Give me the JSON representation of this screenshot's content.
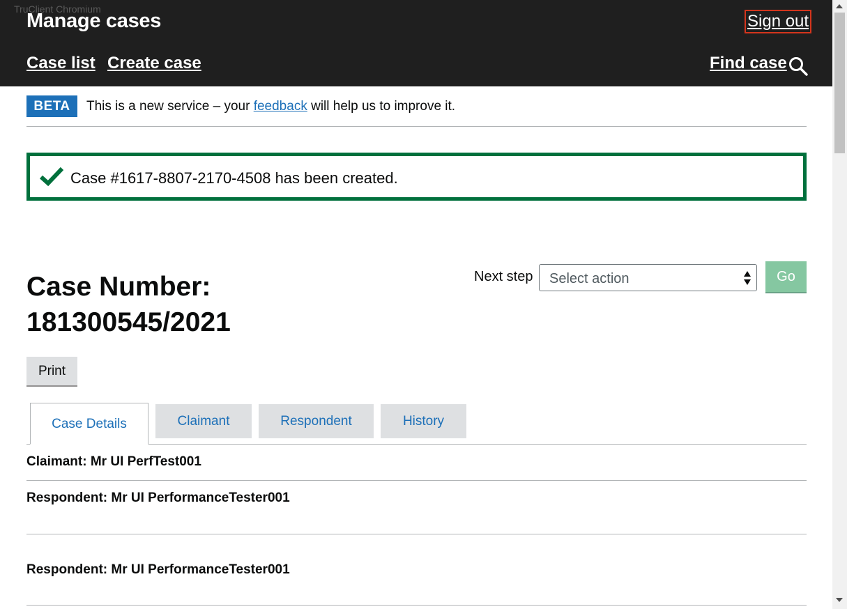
{
  "window": {
    "watermark": "TruClient Chromium"
  },
  "header": {
    "service_name": "Manage cases",
    "sign_out": "Sign out",
    "nav": [
      {
        "label": "Case list"
      },
      {
        "label": "Create case"
      }
    ],
    "find_case": "Find case"
  },
  "beta": {
    "tag": "BETA",
    "text_before": "This is a new service – your ",
    "link": "feedback",
    "text_after": " will help us to improve it."
  },
  "alert": {
    "message": "Case #1617-8807-2170-4508 has been created."
  },
  "case": {
    "title_line1": "Case Number:",
    "title_line2": "181300545/2021"
  },
  "next_step": {
    "label": "Next step",
    "select_value": "Select action",
    "go_label": "Go"
  },
  "print_label": "Print",
  "tabs": [
    {
      "label": "Case Details",
      "active": true
    },
    {
      "label": "Claimant",
      "active": false
    },
    {
      "label": "Respondent",
      "active": false
    },
    {
      "label": "History",
      "active": false
    }
  ],
  "details": [
    "Claimant: Mr UI PerfTest001",
    "Respondent: Mr UI PerformanceTester001",
    "Respondent: Mr UI PerformanceTester001"
  ],
  "colors": {
    "header_bg": "#1f1f1f",
    "brand_blue": "#1d70b8",
    "success_green": "#00703c",
    "go_button": "#85c7a1",
    "focus_red": "#d4351c"
  }
}
